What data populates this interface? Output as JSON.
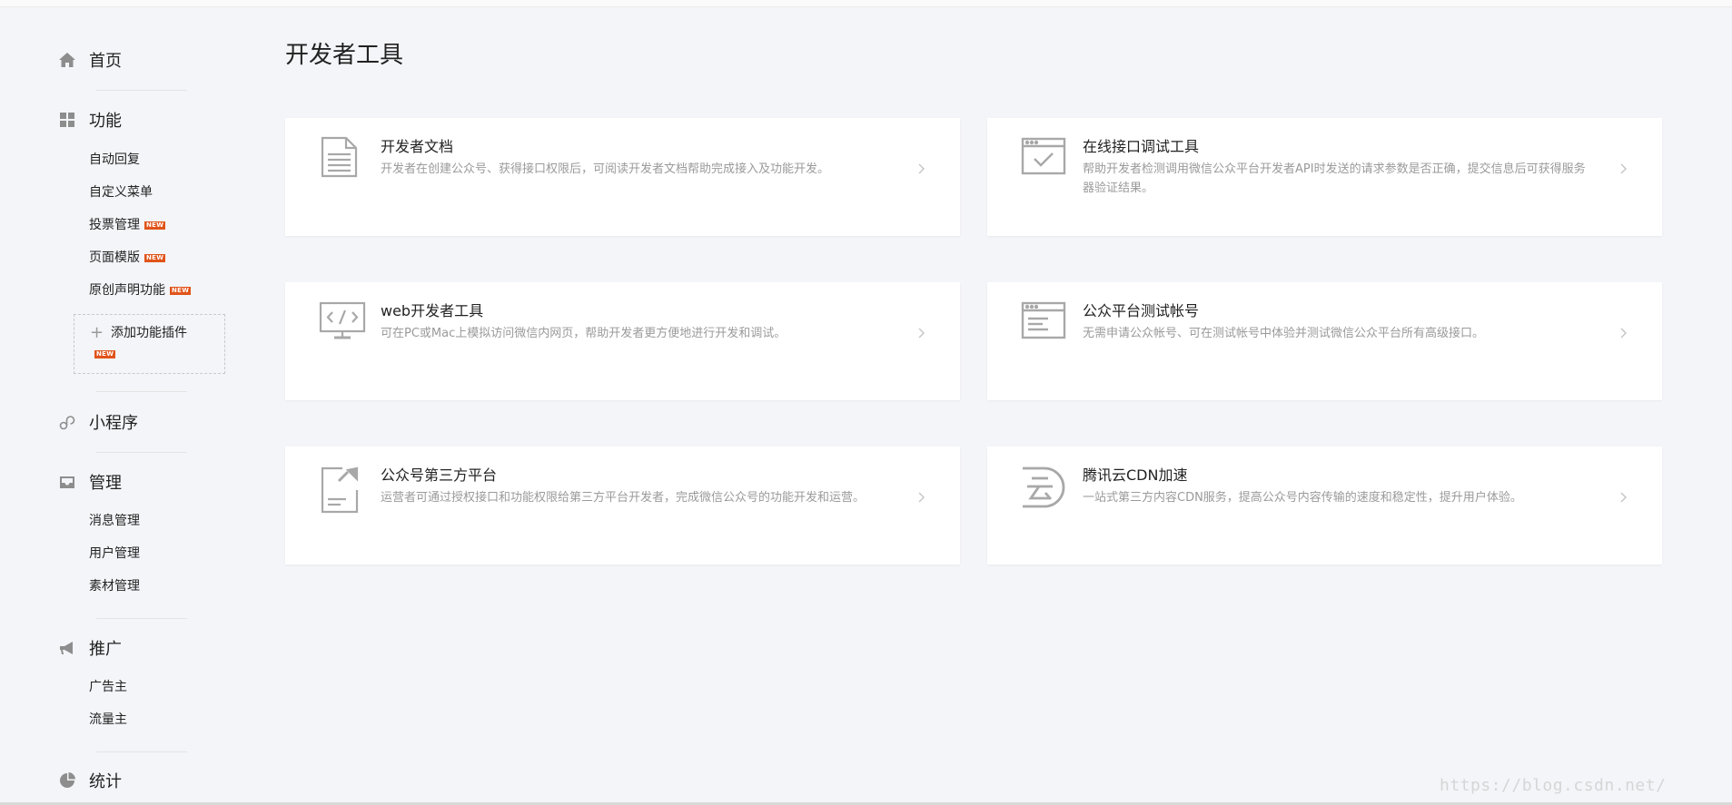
{
  "sidebar": {
    "home": {
      "label": "首页",
      "icon": "home-icon"
    },
    "features": {
      "label": "功能",
      "icon": "grid-icon",
      "items": [
        {
          "label": "自动回复",
          "badge": ""
        },
        {
          "label": "自定义菜单",
          "badge": ""
        },
        {
          "label": "投票管理",
          "badge": "NEW"
        },
        {
          "label": "页面模版",
          "badge": "NEW"
        },
        {
          "label": "原创声明功能",
          "badge": "NEW"
        }
      ],
      "add_plugin": {
        "label": "添加功能插件",
        "badge": "NEW"
      }
    },
    "miniprogram": {
      "label": "小程序",
      "icon": "link-icon"
    },
    "manage": {
      "label": "管理",
      "icon": "inbox-icon",
      "items": [
        {
          "label": "消息管理"
        },
        {
          "label": "用户管理"
        },
        {
          "label": "素材管理"
        }
      ]
    },
    "promote": {
      "label": "推广",
      "icon": "megaphone-icon",
      "items": [
        {
          "label": "广告主"
        },
        {
          "label": "流量主"
        }
      ]
    },
    "stats": {
      "label": "统计",
      "icon": "pie-chart-icon"
    }
  },
  "main": {
    "title": "开发者工具",
    "cards": [
      {
        "title": "开发者文档",
        "desc": "开发者在创建公众号、获得接口权限后，可阅读开发者文档帮助完成接入及功能开发。",
        "icon": "document-icon"
      },
      {
        "title": "在线接口调试工具",
        "desc": "帮助开发者检测调用微信公众平台开发者API时发送的请求参数是否正确，提交信息后可获得服务器验证结果。",
        "icon": "window-check-icon"
      },
      {
        "title": "web开发者工具",
        "desc": "可在PC或Mac上模拟访问微信内网页，帮助开发者更方便地进行开发和调试。",
        "icon": "monitor-code-icon"
      },
      {
        "title": "公众平台测试帐号",
        "desc": "无需申请公众帐号、可在测试帐号中体验并测试微信公众平台所有高级接口。",
        "icon": "window-list-icon"
      },
      {
        "title": "公众号第三方平台",
        "desc": "运营者可通过授权接口和功能权限给第三方平台开发者，完成微信公众号的功能开发和运营。",
        "icon": "document-share-icon"
      },
      {
        "title": "腾讯云CDN加速",
        "desc": "一站式第三方内容CDN服务，提高公众号内容传输的速度和稳定性，提升用户体验。",
        "icon": "cloud-icon"
      }
    ]
  },
  "watermark": "https://blog.csdn.net/"
}
